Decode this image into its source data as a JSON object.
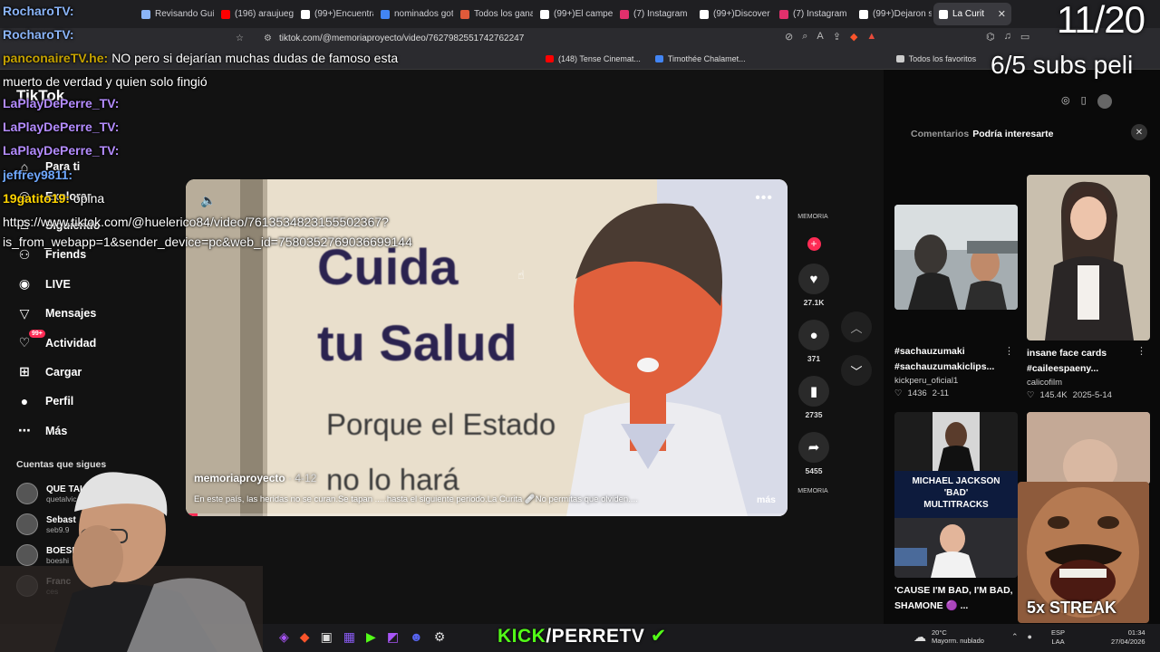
{
  "browser": {
    "tabs": [
      {
        "label": "Revisando Guía",
        "icon": "gemini-icon",
        "color": "#8ab4f8"
      },
      {
        "label": "(196) araujueg",
        "icon": "youtube-icon",
        "color": "#ff0000"
      },
      {
        "label": "(99+)Encuentra",
        "icon": "tiktok-icon",
        "color": "#ffffff"
      },
      {
        "label": "nominados got",
        "icon": "google-icon",
        "color": "#4285f4"
      },
      {
        "label": "Todos los gana",
        "icon": "site-icon",
        "color": "#e05a3a"
      },
      {
        "label": "(99+)El campe",
        "icon": "tiktok-icon",
        "color": "#ffffff"
      },
      {
        "label": "(7) Instagram",
        "icon": "instagram-icon",
        "color": "#e1306c"
      },
      {
        "label": "(99+)Discover",
        "icon": "tiktok-icon",
        "color": "#ffffff"
      },
      {
        "label": "(7) Instagram",
        "icon": "instagram-icon",
        "color": "#e1306c"
      },
      {
        "label": "(99+)Dejaron s",
        "icon": "tiktok-icon",
        "color": "#ffffff"
      },
      {
        "label": "La Curit",
        "icon": "tiktok-icon",
        "color": "#ffffff",
        "active": true
      }
    ],
    "url": "tiktok.com/@memoriaproyecto/video/7627982551742762247",
    "bookmarks": [
      {
        "label": "(148) Tense Cinemat...",
        "icon": "youtube-icon",
        "color": "#ff0000"
      },
      {
        "label": "Timothée Chalamet...",
        "icon": "docs-icon",
        "color": "#4285f4"
      },
      {
        "label": "Todos los favoritos",
        "icon": "folder-icon",
        "color": "#cccccc"
      }
    ]
  },
  "tiktok": {
    "logo": "TikTok",
    "nav": [
      {
        "label": "Para ti",
        "icon": "home-icon",
        "glyph": "⌂"
      },
      {
        "label": "Explorar",
        "icon": "compass-icon",
        "glyph": "◎"
      },
      {
        "label": "Siguiendo",
        "icon": "following-icon",
        "glyph": "♙"
      },
      {
        "label": "Friends",
        "icon": "friends-icon",
        "glyph": "⚇"
      },
      {
        "label": "LIVE",
        "icon": "live-icon",
        "glyph": "◉"
      },
      {
        "label": "Mensajes",
        "icon": "send-icon",
        "glyph": "▽"
      },
      {
        "label": "Actividad",
        "icon": "activity-icon",
        "glyph": "♡",
        "badge": "99+"
      },
      {
        "label": "Cargar",
        "icon": "upload-icon",
        "glyph": "⊞"
      },
      {
        "label": "Perfil",
        "icon": "profile-icon",
        "glyph": "●"
      },
      {
        "label": "Más",
        "icon": "more-icon",
        "glyph": "⋯"
      }
    ],
    "following_title": "Cuentas que sigues",
    "following": [
      {
        "name": "QUE TAL VI",
        "handle": "quetalvic"
      },
      {
        "name": "Sebast",
        "handle": "seb9.9"
      },
      {
        "name": "BOESHI",
        "handle": "boeshi"
      },
      {
        "name": "Franc",
        "handle": "ces"
      }
    ],
    "video": {
      "line1": "Cuida",
      "line2": "tu Salud",
      "line3": "Porque el Estado",
      "line4": "no lo hará",
      "author": "memoriaproyecto",
      "date": "· 4-12",
      "caption": "En este país, las heridas no se curan.Se tapan      .....hasta el siguiente periodo.La Curita 🩹No permitas que olviden....",
      "more": "más",
      "progress": 0.02
    },
    "actions": {
      "author_label": "MEMORIA",
      "likes": "27.1K",
      "comments": "371",
      "saves": "2735",
      "shares": "5455",
      "next_label": "MEMORIA"
    },
    "panel": {
      "tab_comments": "Comentarios",
      "tab_interest": "Podría interesarte",
      "recs": [
        {
          "title": "#sachauzumaki #sachauzumakiclips...",
          "author": "kickperu_oficial1",
          "likes": "1436",
          "date": "2-11"
        },
        {
          "title": "insane face cards #caileespaeny...",
          "author": "calicofilm",
          "likes": "145.4K",
          "date": "2025-5-14"
        },
        {
          "title": "'CAUSE I'M BAD, I'M BAD, SHAMONE 🟣 ...",
          "author": "",
          "likes": "",
          "date": "",
          "thumb_text1": "MICHAEL JACKSON",
          "thumb_text2": "'BAD'",
          "thumb_text3": "MULTITRACKS"
        },
        {
          "title": "",
          "author": "",
          "likes": "",
          "date": ""
        }
      ]
    }
  },
  "taskbar": {
    "weather_temp": "20°C",
    "weather_desc": "Mayorm. nublado",
    "lang1": "ESP",
    "lang2": "LAA",
    "time": "01:34",
    "date": "27/04/2026"
  },
  "overlay": {
    "chat": [
      {
        "user": "RocharoTV:",
        "text": "",
        "color": "#8ab4f8"
      },
      {
        "user": "RocharoTV:",
        "text": "",
        "color": "#8ab4f8"
      },
      {
        "user": "panconaireTV.he:",
        "text": "NO       pero si dejarían muchas dudas de      famoso esta",
        "color": "#c6a300"
      },
      {
        "user": "",
        "text": "muerto de verdad y quien solo fingió",
        "color": "#ffffff"
      },
      {
        "user": "LaPlayDePerre_TV:",
        "text": "",
        "color": "#b48cff"
      },
      {
        "user": "LaPlayDePerre_TV:",
        "text": "",
        "color": "#b48cff"
      },
      {
        "user": "LaPlayDePerre_TV:",
        "text": "",
        "color": "#b48cff"
      },
      {
        "user": "jeffrey9811:",
        "text": "",
        "color": "#6fa8ff"
      },
      {
        "user": "19gatito19:",
        "text": "opina",
        "color": "#ffd400"
      },
      {
        "user": "",
        "text": "https://www.tiktok.com/@huelerico84/video/7613534823155502367?",
        "color": "#ffffff"
      },
      {
        "user": "",
        "text": "is_from_webapp=1&sender_device=pc&web_id=7580352769036699144",
        "color": "#ffffff"
      }
    ],
    "counter": "11/20",
    "subs": "6/5 subs peli",
    "kick_prefix": "KICK",
    "kick_suffix": "/PERRETV",
    "streak": "5x STREAK"
  }
}
